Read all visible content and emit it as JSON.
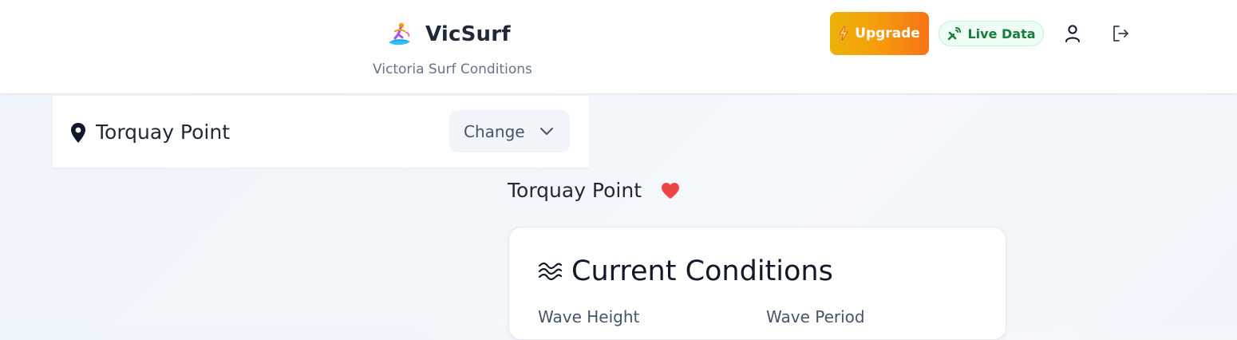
{
  "header": {
    "brand_name": "VicSurf",
    "tagline": "Victoria Surf Conditions",
    "logo_icon": "surfer-emoji",
    "upgrade_label": "Upgrade",
    "live_label": "Live Data",
    "profile_icon": "user-icon",
    "logout_icon": "logout-icon"
  },
  "location_selector": {
    "location_name": "Torquay Point",
    "change_label": "Change"
  },
  "spot": {
    "name": "Torquay Point",
    "favorited": true
  },
  "conditions": {
    "title": "Current Conditions",
    "metrics": [
      {
        "label": "Wave Height"
      },
      {
        "label": "Wave Period"
      }
    ]
  },
  "colors": {
    "upgrade_gradient_start": "#eab308",
    "upgrade_gradient_end": "#f97316",
    "live_green": "#15803d",
    "heart_red": "#ef4444"
  }
}
